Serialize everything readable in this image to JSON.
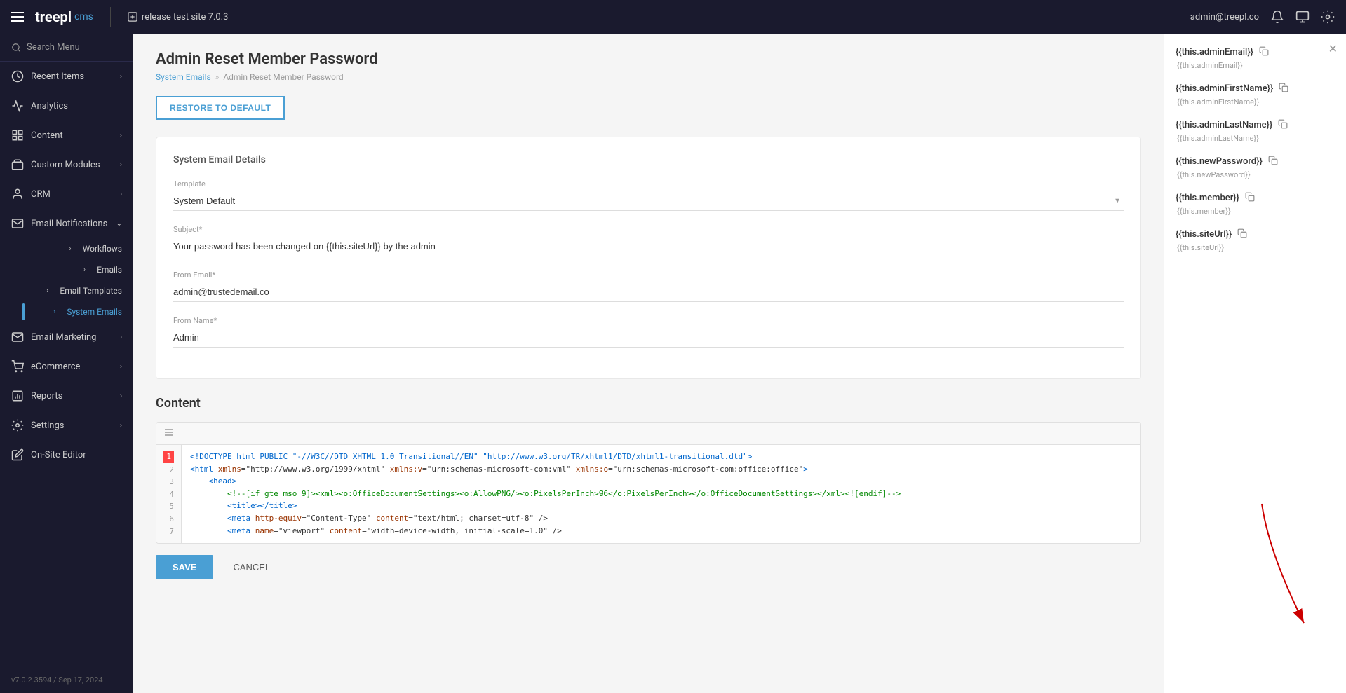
{
  "topNav": {
    "logo": "treepl",
    "logoSuffix": "cms",
    "site": "release test site 7.0.3",
    "user": "admin@treepl.co",
    "hamburgerLabel": "menu"
  },
  "sidebar": {
    "searchPlaceholder": "Search Menu",
    "items": [
      {
        "id": "recent-items",
        "label": "Recent Items",
        "icon": "clock",
        "hasChildren": true
      },
      {
        "id": "analytics",
        "label": "Analytics",
        "icon": "chart-line",
        "hasChildren": false
      },
      {
        "id": "content",
        "label": "Content",
        "icon": "grid",
        "hasChildren": true
      },
      {
        "id": "custom-modules",
        "label": "Custom Modules",
        "icon": "puzzle",
        "hasChildren": true
      },
      {
        "id": "crm",
        "label": "CRM",
        "icon": "person",
        "hasChildren": true
      },
      {
        "id": "email-notifications",
        "label": "Email Notifications",
        "icon": "envelope",
        "hasChildren": true,
        "expanded": true
      },
      {
        "id": "email-marketing",
        "label": "Email Marketing",
        "icon": "mail",
        "hasChildren": true
      },
      {
        "id": "ecommerce",
        "label": "eCommerce",
        "icon": "cart",
        "hasChildren": true
      },
      {
        "id": "reports",
        "label": "Reports",
        "icon": "bar-chart",
        "hasChildren": true
      },
      {
        "id": "settings",
        "label": "Settings",
        "icon": "gear",
        "hasChildren": true
      },
      {
        "id": "on-site-editor",
        "label": "On-Site Editor",
        "icon": "edit",
        "hasChildren": false
      }
    ],
    "subItems": [
      {
        "id": "workflows",
        "label": "Workflows",
        "active": false
      },
      {
        "id": "emails",
        "label": "Emails",
        "active": false
      },
      {
        "id": "email-templates",
        "label": "Email Templates",
        "active": false
      },
      {
        "id": "system-emails",
        "label": "System Emails",
        "active": true
      }
    ],
    "version": "v7.0.2.3594 / Sep 17, 2024"
  },
  "page": {
    "title": "Admin Reset Member Password",
    "breadcrumb": {
      "parent": "System Emails",
      "current": "Admin Reset Member Password"
    },
    "restoreButton": "RESTORE TO DEFAULT",
    "formCardTitle": "System Email Details",
    "fields": {
      "template": {
        "label": "Template",
        "value": "System Default"
      },
      "subject": {
        "label": "Subject*",
        "value": "Your password has been changed on {{this.siteUrl}} by the admin"
      },
      "fromEmail": {
        "label": "From Email*",
        "value": "admin@trustedemail.co"
      },
      "fromName": {
        "label": "From Name*",
        "value": "Admin"
      }
    },
    "contentSection": {
      "title": "Content",
      "codeLines": [
        {
          "num": "1",
          "text": "<!DOCTYPE html PUBLIC \"-//W3C//DTD XHTML 1.0 Transitional//EN\" \"http://www.w3.org/TR/xhtml1/DTD/xhtml1-transitional.dtd\">"
        },
        {
          "num": "2",
          "text": "<html xmlns=\"http://www.w3.org/1999/xhtml\" xmlns:v=\"urn:schemas-microsoft-com:vml\" xmlns:o=\"urn:schemas-microsoft-com:office:office\">"
        },
        {
          "num": "3",
          "text": "    <head>"
        },
        {
          "num": "4",
          "text": "        <!--[if gte mso 9]><xml><o:OfficeDocumentSettings><o:AllowPNG/><o:PixelsPerInch>96</o:PixelsPerInch></o:OfficeDocumentSettings></xml><![endif]-->"
        },
        {
          "num": "5",
          "text": "        <title></title>"
        },
        {
          "num": "6",
          "text": "        <meta http-equiv=\"Content-Type\" content=\"text/html; charset=utf-8\" />"
        },
        {
          "num": "7",
          "text": "        <meta name=\"viewport\" content=\"width=device-width, initial-scale=1.0\" />"
        }
      ]
    },
    "actions": {
      "save": "SAVE",
      "cancel": "CANCEL"
    }
  },
  "rightPanel": {
    "variables": [
      {
        "id": "adminEmail",
        "display": "{{this.adminEmail}}",
        "sub": "{{this.adminEmail}}"
      },
      {
        "id": "adminFirstName",
        "display": "{{this.adminFirstName}}",
        "sub": "{{this.adminFirstName}}"
      },
      {
        "id": "adminLastName",
        "display": "{{this.adminLastName}}",
        "sub": "{{this.adminLastName}}"
      },
      {
        "id": "newPassword",
        "display": "{{this.newPassword}}",
        "sub": "{{this.newPassword}}"
      },
      {
        "id": "member",
        "display": "{{this.member}}",
        "sub": "{{this.member}}"
      },
      {
        "id": "siteUrl",
        "display": "{{this.siteUrl}}",
        "sub": "{{this.siteUrl}}"
      }
    ]
  },
  "colors": {
    "accent": "#4a9fd4",
    "sidebar_bg": "#1a1a2e",
    "active_blue": "#4a9fd4",
    "error_red": "#ff4444"
  }
}
